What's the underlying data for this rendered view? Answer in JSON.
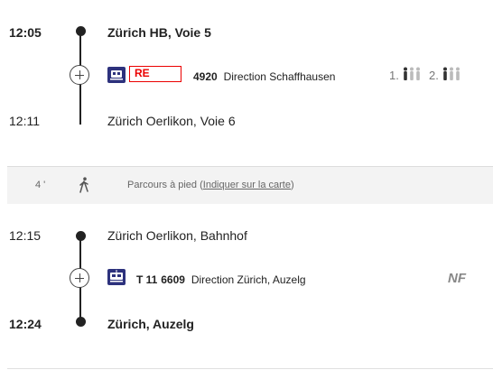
{
  "legs": [
    {
      "dep_time": "12:05",
      "dep_stop": "Zürich HB, Voie 5",
      "product": "RE",
      "number": "4920",
      "direction": "Direction Schaffhausen",
      "class1": "1.",
      "class2": "2.",
      "arr_time": "12:11",
      "arr_stop": "Zürich Oerlikon, Voie 6"
    },
    {
      "dep_time": "12:15",
      "dep_stop": "Zürich Oerlikon, Bahnhof",
      "product_line": "T 11",
      "number": "6609",
      "direction": "Direction Zürich, Auzelg",
      "note": "NF",
      "arr_time": "12:24",
      "arr_stop": "Zürich, Auzelg"
    }
  ],
  "walk": {
    "minutes": "4 '",
    "text": "Parcours à pied (",
    "link": "Indiquer sur la carte",
    "close": ")"
  },
  "icons": {
    "expand": "plus-circle-icon",
    "train": "train-icon",
    "tram": "tram-icon",
    "walk": "walking-person-icon",
    "occupancy": "occupancy-low-icon"
  },
  "colors": {
    "sbb_red": "#eb0000",
    "sbb_blue": "#2d327d"
  }
}
